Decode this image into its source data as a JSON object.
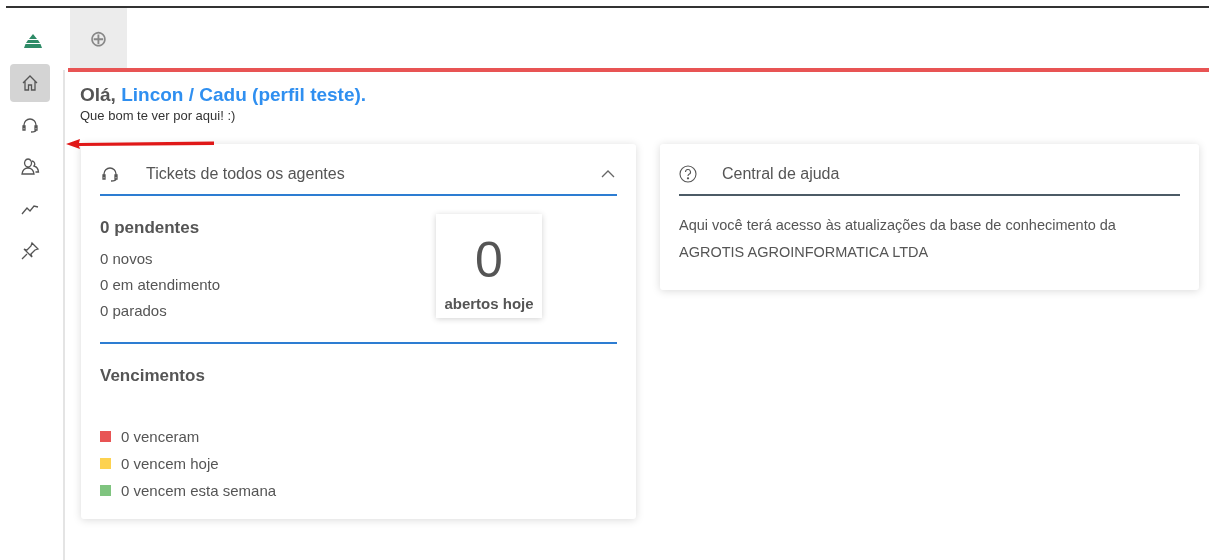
{
  "sidebar": {
    "items": [
      {
        "selected": true
      },
      {
        "selected": false
      },
      {
        "selected": false
      },
      {
        "selected": false
      },
      {
        "selected": false
      }
    ]
  },
  "tabs": [
    {
      "label": "⊕",
      "selected": true
    }
  ],
  "greeting": {
    "hello": "Olá,",
    "name": "Lincon / Cadu (perfil teste).",
    "subtitle": "Que bom te ver por aqui! :)"
  },
  "tickets_card": {
    "title": "Tickets de todos os agentes",
    "expanded": true,
    "pending": "0 pendentes",
    "counts": [
      "0 novos",
      "0 em atendimento",
      "0 parados"
    ],
    "opened_today": {
      "value": "0",
      "label": "abertos hoje"
    },
    "due_title": "Vencimentos",
    "due": [
      {
        "label": "0 venceram",
        "color": "#e85454"
      },
      {
        "label": "0 vencem hoje",
        "color": "#fdd250"
      },
      {
        "label": "0 vencem esta semana",
        "color": "#7fc47f"
      }
    ]
  },
  "help_card": {
    "title": "Central de ajuda",
    "text": "Aqui você terá acesso às atualizações da base de conhecimento da AGROTIS AGROINFORMATICA LTDA"
  }
}
